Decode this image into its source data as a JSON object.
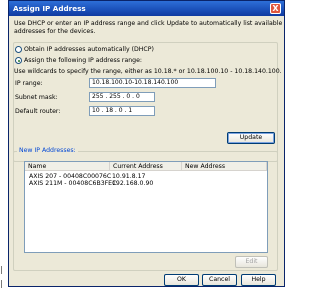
{
  "window": {
    "title": "Assign IP Address",
    "close_label": "X"
  },
  "intro": {
    "line1": "Use DHCP or enter an IP address range and click Update to automatically list available",
    "line2": "addresses for the devices."
  },
  "options": {
    "dhcp_label": "Obtain IP addresses automatically (DHCP)",
    "dhcp_selected": false,
    "manual_label": "Assign the following IP address range:",
    "manual_selected": true
  },
  "wildcard_hint": "Use wildcards to specify the range, either as 10.18.* or 10.18.100.10 - 10.18.140.100.",
  "fields": {
    "ip_range": {
      "label": "IP range:",
      "value": "10.18.100.10-10.18.140.100"
    },
    "subnet_mask": {
      "label": "Subnet mask:",
      "octets": [
        "255",
        "255",
        "0",
        "0"
      ]
    },
    "default_router": {
      "label": "Default router:",
      "octets": [
        "10",
        "18",
        "0",
        "1"
      ]
    }
  },
  "buttons": {
    "update": "Update",
    "edit": "Edit",
    "ok": "OK",
    "cancel": "Cancel",
    "help": "Help"
  },
  "new_ip": {
    "group_label": "New IP Addresses:",
    "columns": [
      "Name",
      "Current Address",
      "New Address"
    ],
    "rows": [
      {
        "name": "AXIS 207 - 00408C00076C",
        "current": "10.91.8.17",
        "new": ""
      },
      {
        "name": "AXIS 211M - 00408C6B3FEC",
        "current": "192.168.0.90",
        "new": ""
      }
    ]
  },
  "colors": {
    "title_bar": "#1a4fb8",
    "group_label": "#0046d5",
    "dialog_bg": "#ece9d8"
  }
}
